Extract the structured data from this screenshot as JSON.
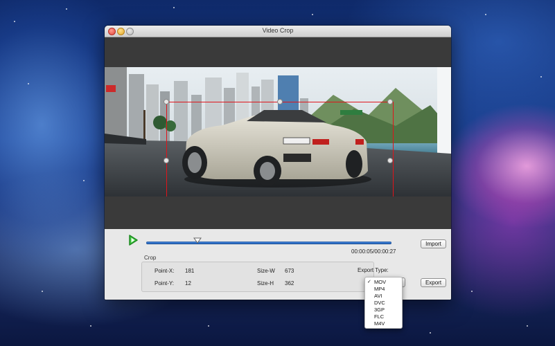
{
  "window": {
    "title": "Video Crop"
  },
  "playback": {
    "time": "00:00:05/00:00:27",
    "position": 0.21,
    "import_label": "Import"
  },
  "crop": {
    "section_label": "Crop",
    "point_x_label": "Point-X:",
    "point_x_value": "181",
    "point_y_label": "Point-Y:",
    "point_y_value": "12",
    "size_w_label": "Size-W",
    "size_w_value": "673",
    "size_h_label": "Size-H",
    "size_h_value": "362"
  },
  "export": {
    "type_label": "Export Type:",
    "export_label": "Export",
    "selected": "MOV",
    "options": [
      "MOV",
      "MP4",
      "AVI",
      "DVC",
      "3GP",
      "FLC",
      "M4V"
    ]
  },
  "colors": {
    "crop_border": "#e0141a",
    "slider": "#2f6fc8",
    "play": "#3ec43e"
  },
  "icons": [
    "play-icon",
    "slider-thumb-icon",
    "checkmark-icon"
  ]
}
